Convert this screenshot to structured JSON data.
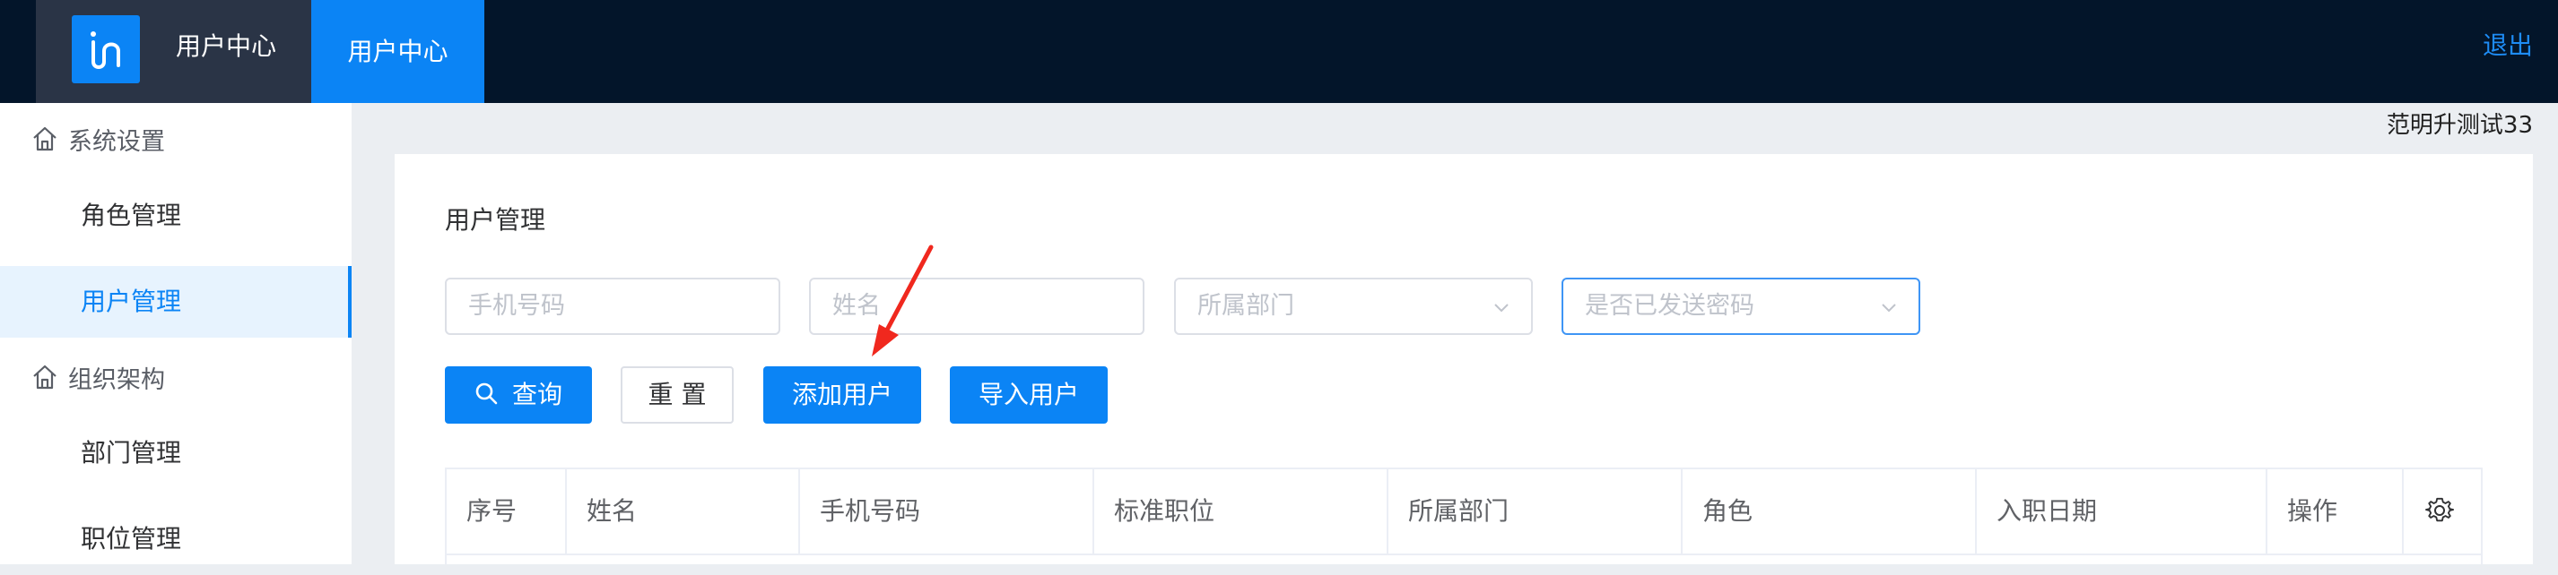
{
  "topbar": {
    "brand_title": "用户中心",
    "active_tab": "用户中心",
    "logout": "退出"
  },
  "user": {
    "name": "范明升测试33"
  },
  "sidebar": {
    "groups": [
      {
        "label": "系统设置",
        "icon": "home-icon"
      },
      {
        "label": "组织架构",
        "icon": "home-icon"
      }
    ],
    "items": [
      {
        "label": "角色管理",
        "active": false
      },
      {
        "label": "用户管理",
        "active": true
      },
      {
        "label": "部门管理",
        "active": false
      },
      {
        "label": "职位管理",
        "active": false
      }
    ]
  },
  "main": {
    "title": "用户管理",
    "filters": {
      "phone_placeholder": "手机号码",
      "name_placeholder": "姓名",
      "dept_placeholder": "所属部门",
      "password_sent_placeholder": "是否已发送密码"
    },
    "buttons": {
      "search": "查询",
      "reset": "重 置",
      "add_user": "添加用户",
      "import_users": "导入用户"
    },
    "table": {
      "columns": [
        "序号",
        "姓名",
        "手机号码",
        "标准职位",
        "所属部门",
        "角色",
        "入职日期",
        "操作"
      ],
      "settings_icon": "gear-icon"
    }
  },
  "colors": {
    "topbar_bg": "#03152a",
    "brand_bg": "#2a3446",
    "primary": "#0b84f5",
    "annotation_arrow": "#f0281e"
  }
}
